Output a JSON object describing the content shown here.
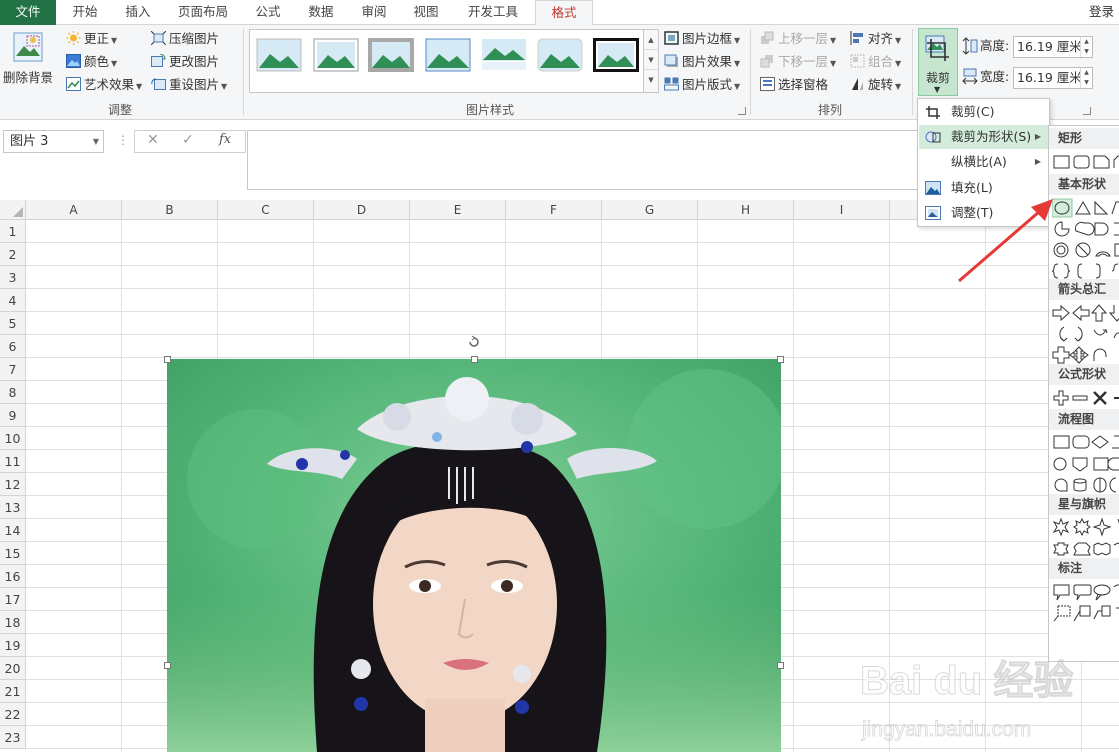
{
  "tabs": {
    "file": "文件",
    "home": "开始",
    "insert": "插入",
    "layout": "页面布局",
    "formulas": "公式",
    "data": "数据",
    "review": "审阅",
    "view": "视图",
    "developer": "开发工具",
    "format": "格式",
    "login": "登录"
  },
  "ribbon": {
    "adjust": {
      "remove_bg": "删除背景",
      "corrections": "更正",
      "color": "颜色",
      "artistic": "艺术效果",
      "compress": "压缩图片",
      "change": "更改图片",
      "reset": "重设图片",
      "group_label": "调整"
    },
    "styles": {
      "border": "图片边框",
      "effects": "图片效果",
      "layout": "图片版式",
      "group_label": "图片样式"
    },
    "arrange": {
      "bring_forward": "上移一层",
      "send_backward": "下移一层",
      "selection_pane": "选择窗格",
      "align": "对齐",
      "group": "组合",
      "rotate": "旋转",
      "group_label": "排列"
    },
    "size": {
      "crop": "裁剪",
      "height_label": "高度:",
      "height_value": "16.19 厘米",
      "width_label": "宽度:",
      "width_value": "16.19 厘米"
    }
  },
  "formula_bar": {
    "name_box": "图片 3",
    "fx": "fx",
    "cancel": "✕",
    "enter": "✓"
  },
  "columns": [
    "A",
    "B",
    "C",
    "D",
    "E",
    "F",
    "G",
    "H",
    "I"
  ],
  "rows": [
    "1",
    "2",
    "3",
    "4",
    "5",
    "6",
    "7",
    "8",
    "9",
    "10",
    "11",
    "12",
    "13",
    "14",
    "15",
    "16",
    "17",
    "18",
    "19",
    "20",
    "21",
    "22",
    "23"
  ],
  "crop_menu": {
    "crop": "裁剪(C)",
    "crop_to_shape": "裁剪为形状(S)",
    "aspect_ratio": "纵横比(A)",
    "fill": "填充(L)",
    "fit": "调整(T)"
  },
  "shapes_panel": {
    "rect": "矩形",
    "basic": "基本形状",
    "arrows": "箭头总汇",
    "equation": "公式形状",
    "flowchart": "流程图",
    "stars": "星与旗帜",
    "callouts": "标注"
  },
  "watermark": {
    "brand": "Bai du 经验",
    "url": "jingyan.baidu.com"
  },
  "colors": {
    "accent": "#217346",
    "format_tab": "#c0372f",
    "highlight": "#d3ecdc",
    "arrow": "#e53935"
  }
}
